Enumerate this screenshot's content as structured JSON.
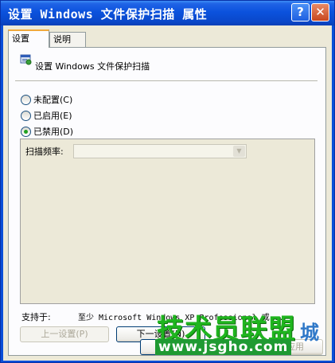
{
  "window": {
    "title": "设置 Windows 文件保护扫描 属性",
    "help_button": "?",
    "close_button": "✕"
  },
  "tabs": [
    {
      "label": "设置",
      "active": true
    },
    {
      "label": "说明",
      "active": false
    }
  ],
  "policy": {
    "icon": "policy-setting-icon",
    "title": "设置 Windows 文件保护扫描"
  },
  "options": [
    {
      "label": "未配置(C)",
      "selected": false
    },
    {
      "label": "已启用(E)",
      "selected": false
    },
    {
      "label": "已禁用(D)",
      "selected": true
    }
  ],
  "scan_frequency": {
    "label": "扫描频率:",
    "value": ""
  },
  "supported_on": {
    "label": "支持于:",
    "value": "至少 Microsoft Windows XP Professional 或..."
  },
  "buttons": {
    "previous": "上一设置(P)",
    "next": "下一设置(N)",
    "ok": "确定",
    "cancel": "取消",
    "apply": "应用"
  },
  "watermark": {
    "main": "技术员联盟",
    "side": "城",
    "url": "www.jsgho.com"
  },
  "colors": {
    "titlebar": "#0a52dd",
    "dialog_bg": "#ece9d8",
    "accent_tab": "#f1a93b",
    "radio_selected": "#21a121"
  }
}
